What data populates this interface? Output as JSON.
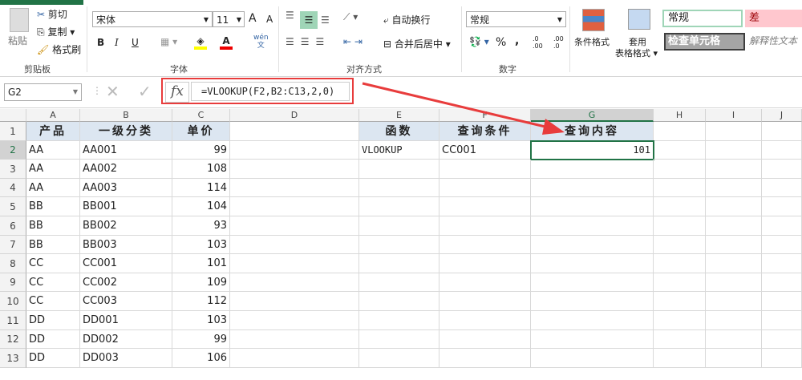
{
  "ribbon": {
    "clipboard": {
      "paste": "粘贴",
      "cut": "剪切",
      "copy": "复制",
      "format_painter": "格式刷",
      "group": "剪贴板"
    },
    "font": {
      "name": "宋体",
      "size": "11",
      "bold": "B",
      "italic": "I",
      "underline": "U",
      "font_color": "A",
      "phonetic": "wén",
      "phonetic2": "文",
      "group": "字体",
      "grow": "A",
      "shrink": "A"
    },
    "alignment": {
      "wrap": "自动换行",
      "merge": "合并后居中",
      "group": "对齐方式"
    },
    "number": {
      "format": "常规",
      "percent": "%",
      "comma": ",",
      "inc": ".0 .00",
      "dec": ".00 .0",
      "group": "数字"
    },
    "styles": {
      "conditional": "条件格式",
      "table": "套用",
      "table2": "表格格式",
      "normal": "常规",
      "bad": "差",
      "check": "检查单元格",
      "explanatory": "解释性文本"
    }
  },
  "formula_bar": {
    "name_box": "G2",
    "fx": "fx",
    "formula": "=VLOOKUP(F2,B2:C13,2,0)"
  },
  "columns": [
    "A",
    "B",
    "C",
    "D",
    "E",
    "F",
    "G",
    "H",
    "I",
    "J"
  ],
  "rows": [
    "1",
    "2",
    "3",
    "4",
    "5",
    "6",
    "7",
    "8",
    "9",
    "10",
    "11",
    "12",
    "13"
  ],
  "table": {
    "headers": [
      "产品",
      "一级分类",
      "单价"
    ],
    "data": [
      [
        "AA",
        "AA001",
        "99"
      ],
      [
        "AA",
        "AA002",
        "108"
      ],
      [
        "AA",
        "AA003",
        "114"
      ],
      [
        "BB",
        "BB001",
        "104"
      ],
      [
        "BB",
        "BB002",
        "93"
      ],
      [
        "BB",
        "BB003",
        "103"
      ],
      [
        "CC",
        "CC001",
        "101"
      ],
      [
        "CC",
        "CC002",
        "109"
      ],
      [
        "CC",
        "CC003",
        "112"
      ],
      [
        "DD",
        "DD001",
        "103"
      ],
      [
        "DD",
        "DD002",
        "99"
      ],
      [
        "DD",
        "DD003",
        "106"
      ]
    ]
  },
  "lookup": {
    "headers": [
      "函数",
      "查询条件",
      "查询内容"
    ],
    "values": [
      "VLOOKUP",
      "CC001",
      "101"
    ]
  },
  "colors": {
    "header_fill": "#dce6f1",
    "highlight": "#e83c3c",
    "selection": "#217346"
  }
}
